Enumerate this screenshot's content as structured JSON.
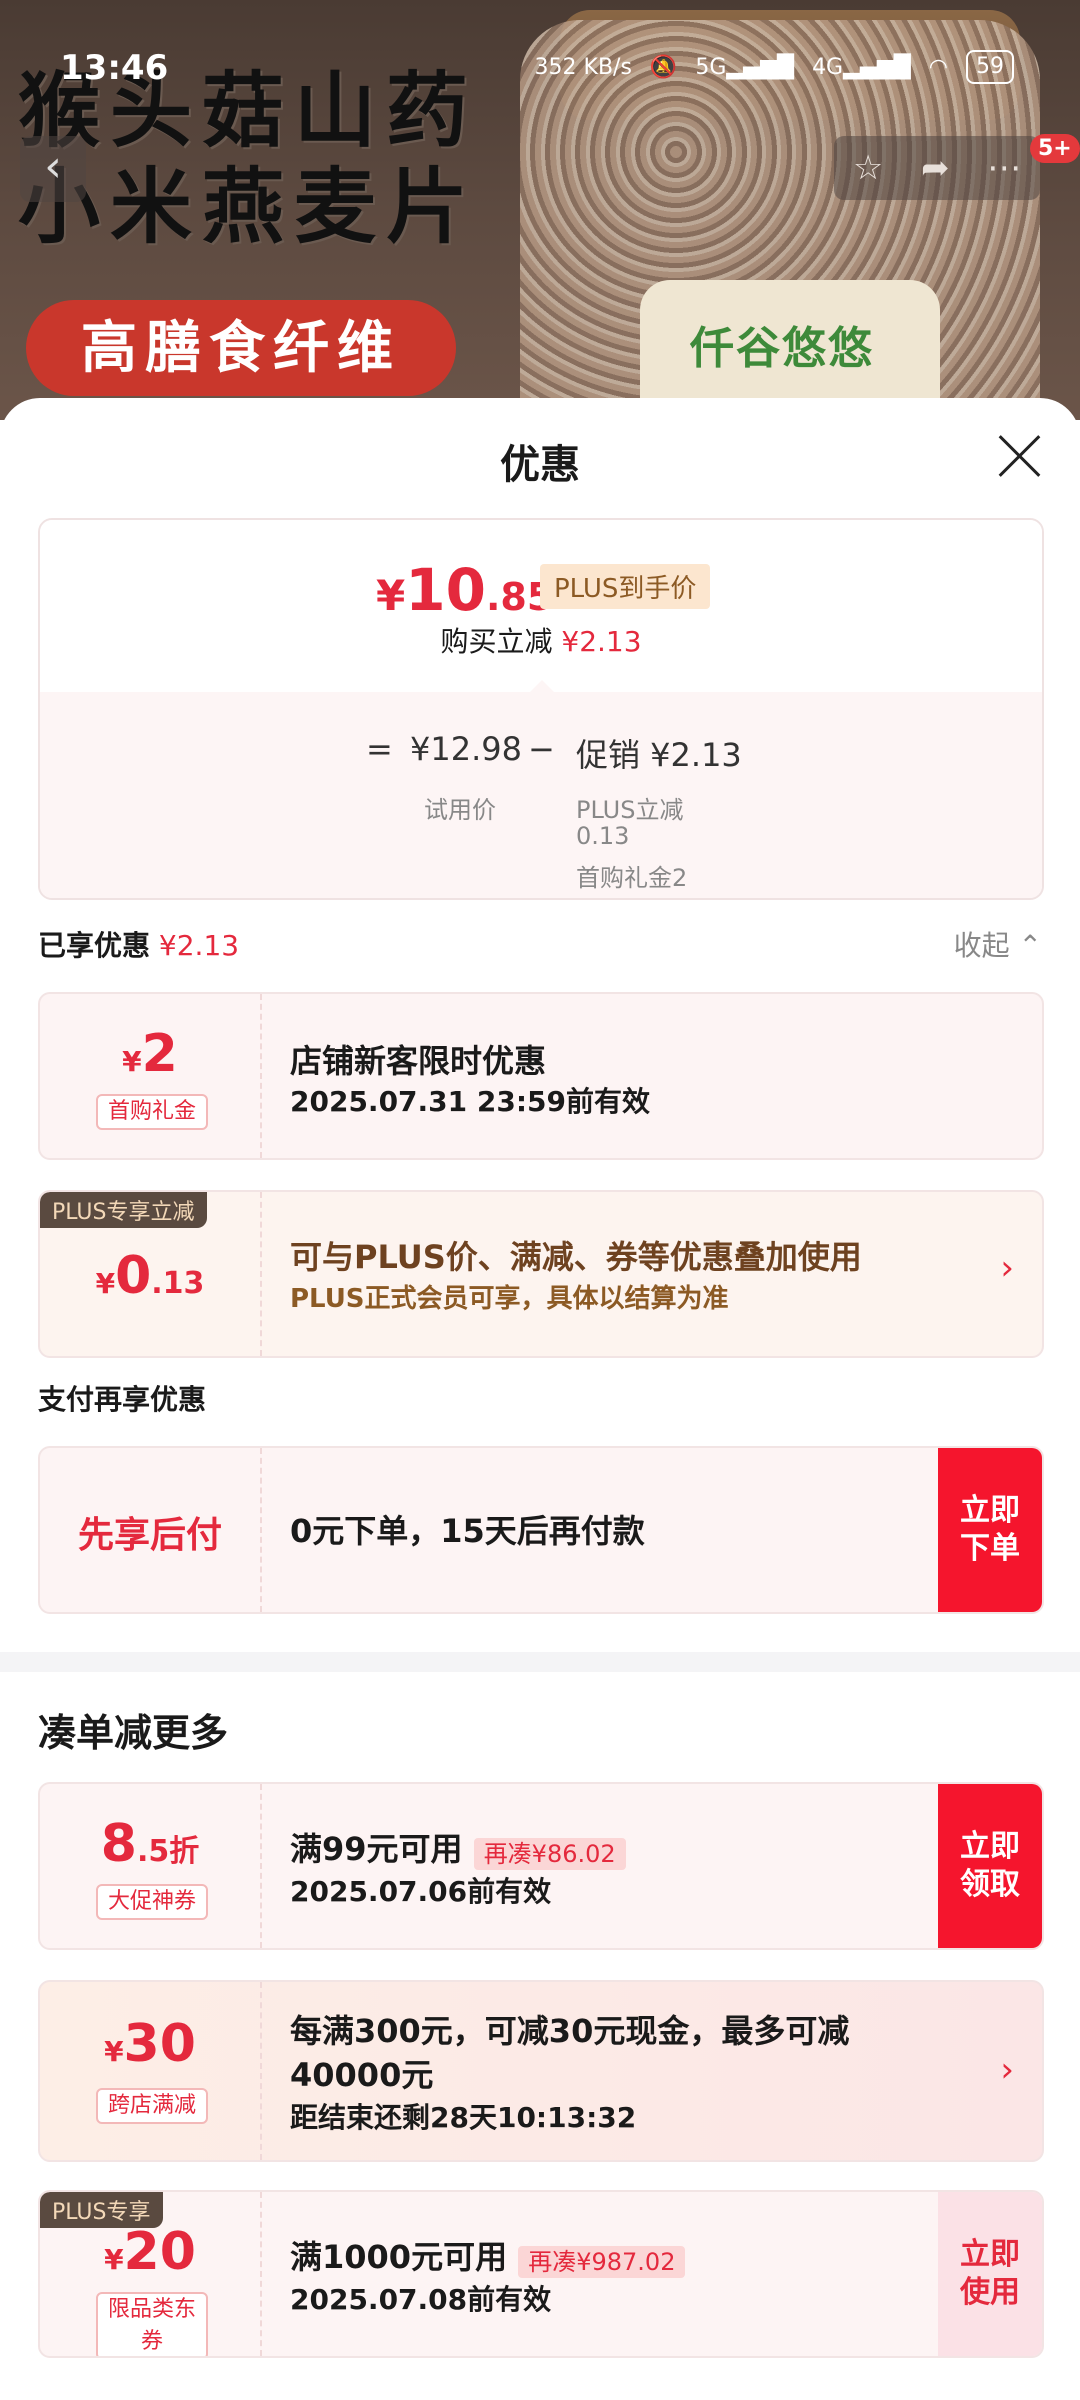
{
  "status": {
    "time": "13:46",
    "speed": "352 KB/s",
    "net1": "5G",
    "net2": "4G",
    "battery": "59"
  },
  "hero": {
    "title_line1": "猴头菇山药",
    "title_line2": "小米燕麦片",
    "badge": "高膳食纤维",
    "brand": "仟谷悠悠",
    "message_count": "5+"
  },
  "sheet": {
    "title": "优惠",
    "price": {
      "currency": "¥",
      "integer": "10",
      "decimal": ".85",
      "tag": "PLUS到手价"
    },
    "buy_reduce_label": "购买立减",
    "buy_reduce_value": "¥2.13",
    "formula": {
      "eq": "=",
      "base": "¥12.98",
      "base_label": "试用价",
      "minus": "−",
      "promo": "促销 ¥2.13",
      "promo_detail1": "PLUS立减",
      "promo_detail2": "0.13",
      "promo_detail3": "首购礼金2"
    },
    "enjoyed_label": "已享优惠",
    "enjoyed_value": "¥2.13",
    "collapse_label": "收起 ⌃"
  },
  "coupons": [
    {
      "currency": "¥",
      "amount": "2",
      "tag": "首购礼金",
      "title": "店铺新客限时优惠",
      "sub": "2025.07.31 23:59前有效"
    },
    {
      "corner": "PLUS专享立减",
      "currency": "¥",
      "amount": "0",
      "decimal": ".13",
      "title": "可与PLUS价、满减、券等优惠叠加使用",
      "sub": "PLUS正式会员可享，具体以结算为准",
      "arrow": "›"
    }
  ],
  "pay_section": {
    "title": "支付再享优惠",
    "left": "先享后付",
    "main": "0元下单，15天后再付款",
    "button": "立即\n下单"
  },
  "more_section": {
    "title": "凑单减更多",
    "items": [
      {
        "amount": "8",
        "decimal": ".5折",
        "tag": "大促神券",
        "title": "满99元可用",
        "pill": "再凑¥86.02",
        "sub": "2025.07.06前有效",
        "button": "立即\n领取"
      },
      {
        "currency": "¥",
        "amount": "30",
        "tag": "跨店满减",
        "title1": "每满300元，可减30元现金，最多可减",
        "title2": "40000元",
        "countdown": "距结束还剩28天10:13:32",
        "arrow": "›"
      },
      {
        "corner": "PLUS专享",
        "currency": "¥",
        "amount": "20",
        "tag": "限品类东券",
        "title": "满1000元可用",
        "pill": "再凑¥987.02",
        "sub": "2025.07.08前有效",
        "button": "立即\n使用"
      }
    ]
  }
}
